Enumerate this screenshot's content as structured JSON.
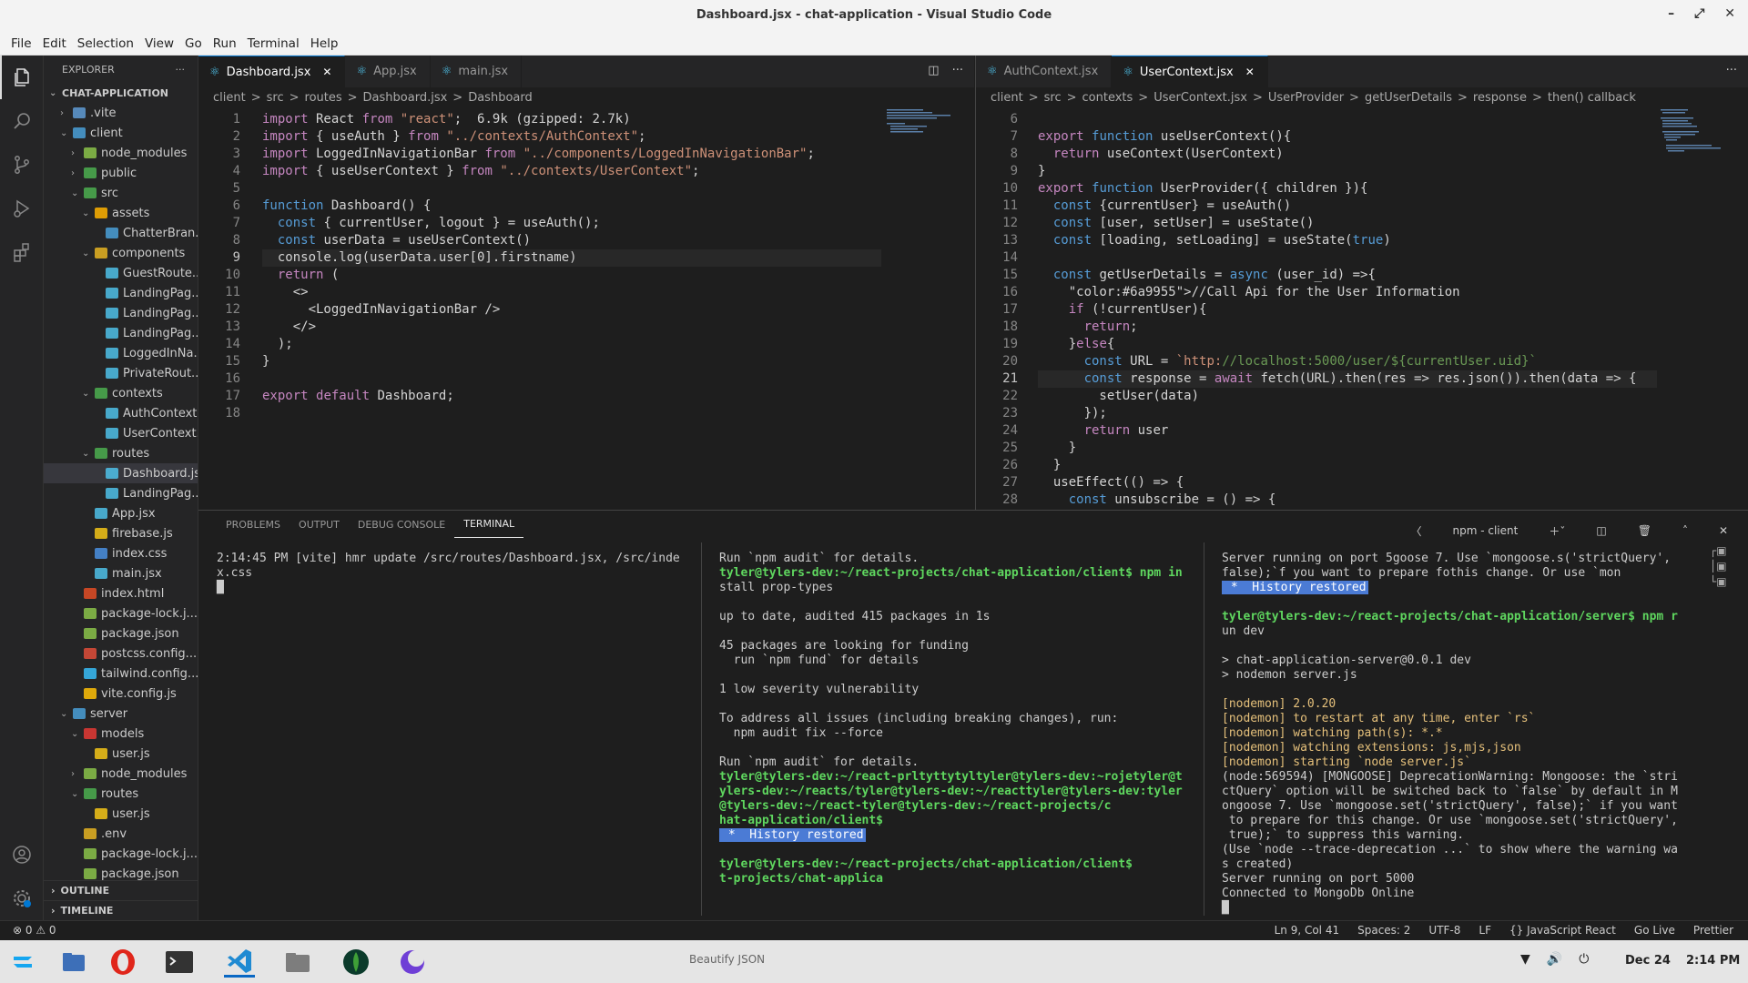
{
  "window": {
    "title": "Dashboard.jsx - chat-application - Visual Studio Code"
  },
  "menu": [
    "File",
    "Edit",
    "Selection",
    "View",
    "Go",
    "Run",
    "Terminal",
    "Help"
  ],
  "sidebar": {
    "header": "EXPLORER",
    "tree": [
      {
        "label": "CHAT-APPLICATION",
        "depth": 0,
        "twisty": "v",
        "icon": "none",
        "section": true
      },
      {
        "label": ".vite",
        "depth": 1,
        "twisty": ">",
        "icon": "#5f9bd5"
      },
      {
        "label": "client",
        "depth": 1,
        "twisty": "v",
        "icon": "#4aa0d8"
      },
      {
        "label": "node_modules",
        "depth": 2,
        "twisty": ">",
        "icon": "#8bc34a"
      },
      {
        "label": "public",
        "depth": 2,
        "twisty": ">",
        "icon": "#4caf50"
      },
      {
        "label": "src",
        "depth": 2,
        "twisty": "v",
        "icon": "#4caf50"
      },
      {
        "label": "assets",
        "depth": 3,
        "twisty": "v",
        "icon": "#ffb300"
      },
      {
        "label": "ChatterBran...",
        "depth": 4,
        "twisty": "",
        "icon": "#4aa0d8"
      },
      {
        "label": "components",
        "depth": 3,
        "twisty": "v",
        "icon": "#e6b422"
      },
      {
        "label": "GuestRoute....",
        "depth": 4,
        "twisty": "",
        "icon": "#4fc1e9"
      },
      {
        "label": "LandingPag...",
        "depth": 4,
        "twisty": "",
        "icon": "#4fc1e9"
      },
      {
        "label": "LandingPag...",
        "depth": 4,
        "twisty": "",
        "icon": "#4fc1e9"
      },
      {
        "label": "LandingPag...",
        "depth": 4,
        "twisty": "",
        "icon": "#4fc1e9"
      },
      {
        "label": "LoggedInNa...",
        "depth": 4,
        "twisty": "",
        "icon": "#4fc1e9"
      },
      {
        "label": "PrivateRout...",
        "depth": 4,
        "twisty": "",
        "icon": "#4fc1e9"
      },
      {
        "label": "contexts",
        "depth": 3,
        "twisty": "v",
        "icon": "#4caf50"
      },
      {
        "label": "AuthContext...",
        "depth": 4,
        "twisty": "",
        "icon": "#4fc1e9"
      },
      {
        "label": "UserContext...",
        "depth": 4,
        "twisty": "",
        "icon": "#4fc1e9"
      },
      {
        "label": "routes",
        "depth": 3,
        "twisty": "v",
        "icon": "#4caf50"
      },
      {
        "label": "Dashboard.jsx",
        "depth": 4,
        "twisty": "",
        "icon": "#4fc1e9",
        "selected": true
      },
      {
        "label": "LandingPag...",
        "depth": 4,
        "twisty": "",
        "icon": "#4fc1e9"
      },
      {
        "label": "App.jsx",
        "depth": 3,
        "twisty": "",
        "icon": "#4fc1e9"
      },
      {
        "label": "firebase.js",
        "depth": 3,
        "twisty": "",
        "icon": "#f5c518"
      },
      {
        "label": "index.css",
        "depth": 3,
        "twisty": "",
        "icon": "#4a90e2"
      },
      {
        "label": "main.jsx",
        "depth": 3,
        "twisty": "",
        "icon": "#4fc1e9"
      },
      {
        "label": "index.html",
        "depth": 2,
        "twisty": "",
        "icon": "#e44d26"
      },
      {
        "label": "package-lock.j...",
        "depth": 2,
        "twisty": "",
        "icon": "#8bc34a"
      },
      {
        "label": "package.json",
        "depth": 2,
        "twisty": "",
        "icon": "#8bc34a"
      },
      {
        "label": "postcss.config...",
        "depth": 2,
        "twisty": "",
        "icon": "#e04e39"
      },
      {
        "label": "tailwind.config...",
        "depth": 2,
        "twisty": "",
        "icon": "#38bdf8"
      },
      {
        "label": "vite.config.js",
        "depth": 2,
        "twisty": "",
        "icon": "#ffc107"
      },
      {
        "label": "server",
        "depth": 1,
        "twisty": "v",
        "icon": "#4aa0d8"
      },
      {
        "label": "models",
        "depth": 2,
        "twisty": "v",
        "icon": "#e53935"
      },
      {
        "label": "user.js",
        "depth": 3,
        "twisty": "",
        "icon": "#f5c518"
      },
      {
        "label": "node_modules",
        "depth": 2,
        "twisty": ">",
        "icon": "#8bc34a"
      },
      {
        "label": "routes",
        "depth": 2,
        "twisty": "v",
        "icon": "#4caf50"
      },
      {
        "label": "user.js",
        "depth": 3,
        "twisty": "",
        "icon": "#f5c518"
      },
      {
        "label": ".env",
        "depth": 2,
        "twisty": "",
        "icon": "#e6b422"
      },
      {
        "label": "package-lock.j...",
        "depth": 2,
        "twisty": "",
        "icon": "#8bc34a"
      },
      {
        "label": "package.json",
        "depth": 2,
        "twisty": "",
        "icon": "#8bc34a"
      }
    ],
    "outline": "OUTLINE",
    "timeline": "TIMELINE"
  },
  "editor1": {
    "tabs": [
      "Dashboard.jsx",
      "App.jsx",
      "main.jsx"
    ],
    "breadcrumbs": [
      "client",
      ">",
      "src",
      ">",
      "routes",
      ">",
      "Dashboard.jsx",
      ">",
      "Dashboard"
    ],
    "lines": [
      "import React from \"react\";  6.9k (gzipped: 2.7k)",
      "import { useAuth } from \"../contexts/AuthContext\";",
      "import LoggedInNavigationBar from \"../components/LoggedInNavigationBar\";",
      "import { useUserContext } from \"../contexts/UserContext\";",
      "",
      "function Dashboard() {",
      "  const { currentUser, logout } = useAuth();",
      "  const userData = useUserContext()",
      "  console.log(userData.user[0].firstname)",
      "  return (",
      "    <>",
      "      <LoggedInNavigationBar />",
      "    </>",
      "  );",
      "}",
      "",
      "export default Dashboard;",
      ""
    ],
    "current_line": 9
  },
  "editor2": {
    "tabs": [
      "AuthContext.jsx",
      "UserContext.jsx"
    ],
    "breadcrumbs": [
      "client",
      ">",
      "src",
      ">",
      "contexts",
      ">",
      "UserContext.jsx",
      ">",
      "UserProvider",
      ">",
      "getUserDetails",
      ">",
      "response",
      ">",
      "then() callback"
    ],
    "first_line": 6,
    "lines": [
      "",
      "export function useUserContext(){",
      "  return useContext(UserContext)",
      "}",
      "export function UserProvider({ children }){",
      "  const {currentUser} = useAuth()",
      "  const [user, setUser] = useState()",
      "  const [loading, setLoading] = useState(true)",
      "",
      "  const getUserDetails = async (user_id) =>{",
      "    //Call Api for the User Information",
      "    if (!currentUser){",
      "      return;",
      "    }else{",
      "      const URL = `http://localhost:5000/user/${currentUser.uid}`",
      "      const response = await fetch(URL).then(res => res.json()).then(data => {",
      "        setUser(data)",
      "      });",
      "      return user",
      "    }",
      "  }",
      "  useEffect(() => {",
      "    const unsubscribe = () => {"
    ],
    "current_line": 21
  },
  "panel": {
    "tabs": [
      "PROBLEMS",
      "OUTPUT",
      "DEBUG CONSOLE",
      "TERMINAL"
    ],
    "terminal_name": "npm - client",
    "term1": [
      "2:14:45 PM [vite] hmr update /src/routes/Dashboard.jsx, /src/inde",
      "x.css",
      "█"
    ],
    "term2": [
      "Run `npm audit` for details.",
      "tyler@tylers-dev:~/react-projects/chat-application/client$ npm in",
      "stall prop-types",
      "",
      "up to date, audited 415 packages in 1s",
      "",
      "45 packages are looking for funding",
      "  run `npm fund` for details",
      "",
      "1 low severity vulnerability",
      "",
      "To address all issues (including breaking changes), run:",
      "  npm audit fix --force",
      "",
      "Run `npm audit` for details.",
      "tyler@tylers-dev:~/react-prltyttytyltyler@tylers-dev:~rojetyler@t",
      "ylers-dev:~/reacts/tyler@tylers-dev:~/reacttyler@tylers-dev:tyler",
      "@tylers-dev:~/react-tyler@tylers-dev:~/react-projects/c",
      "hat-application/client$",
      " *  History restored",
      "",
      "tyler@tylers-dev:~/react-projects/chat-application/client$",
      "t-projects/chat-applica"
    ],
    "term3": [
      "Server running on port 5goose 7. Use `mongoose.s('strictQuery',",
      "false);`f you want to prepare fothis change. Or use `mon",
      " *  History restored",
      "",
      "tyler@tylers-dev:~/react-projects/chat-application/server$ npm r",
      "un dev",
      "",
      "> chat-application-server@0.0.1 dev",
      "> nodemon server.js",
      "",
      "[nodemon] 2.0.20",
      "[nodemon] to restart at any time, enter `rs`",
      "[nodemon] watching path(s): *.*",
      "[nodemon] watching extensions: js,mjs,json",
      "[nodemon] starting `node server.js`",
      "(node:569594) [MONGOOSE] DeprecationWarning: Mongoose: the `stri",
      "ctQuery` option will be switched back to `false` by default in M",
      "ongoose 7. Use `mongoose.set('strictQuery', false);` if you want",
      " to prepare for this change. Or use `mongoose.set('strictQuery',",
      " true);` to suppress this warning.",
      "(Use `node --trace-deprecation ...` to show where the warning wa",
      "s created)",
      "Server running on port 5000",
      "Connected to MongoDb Online",
      "█"
    ]
  },
  "status": {
    "left": "⊗ 0 ⚠ 0",
    "items": [
      "Ln 9, Col 41",
      "Spaces: 2",
      "UTF-8",
      "LF",
      "{} JavaScript React",
      "Go Live",
      "Prettier"
    ]
  },
  "taskbar": {
    "labels": [
      "Beautify JSON",
      "Dec 24",
      "2:14 PM"
    ]
  }
}
